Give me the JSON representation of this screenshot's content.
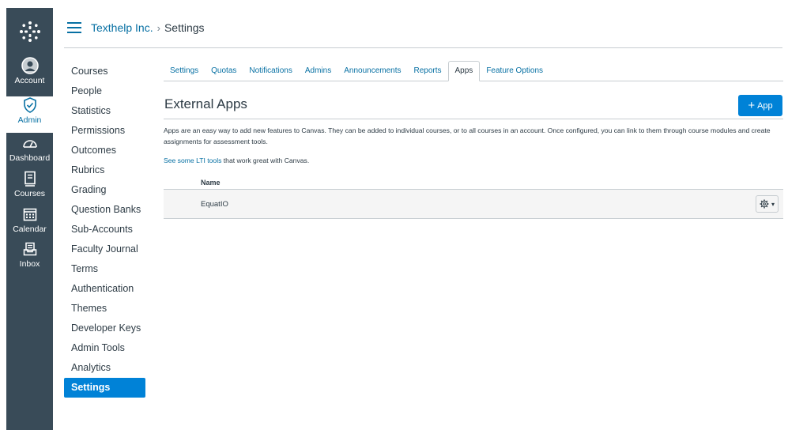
{
  "global_nav": {
    "account": "Account",
    "admin": "Admin",
    "dashboard": "Dashboard",
    "courses": "Courses",
    "calendar": "Calendar",
    "inbox": "Inbox"
  },
  "breadcrumb": {
    "account": "Texthelp Inc.",
    "separator": "›",
    "current": "Settings"
  },
  "context_nav": [
    "Courses",
    "People",
    "Statistics",
    "Permissions",
    "Outcomes",
    "Rubrics",
    "Grading",
    "Question Banks",
    "Sub-Accounts",
    "Faculty Journal",
    "Terms",
    "Authentication",
    "Themes",
    "Developer Keys",
    "Admin Tools",
    "Analytics",
    "Settings"
  ],
  "tabs": [
    "Settings",
    "Quotas",
    "Notifications",
    "Admins",
    "Announcements",
    "Reports",
    "Apps",
    "Feature Options"
  ],
  "active_tab": "Apps",
  "page": {
    "title": "External Apps",
    "add_button_label": "App",
    "description": "Apps are an easy way to add new features to Canvas. They can be added to individual courses, or to all courses in an account. Once configured, you can link to them through course modules and create assignments for assessment tools.",
    "lti_link": "See some LTI tools",
    "lti_rest": " that work great with Canvas."
  },
  "table": {
    "header_name": "Name",
    "rows": [
      {
        "name": "EquatIO"
      }
    ]
  },
  "colors": {
    "nav_bg": "#394b58",
    "accent": "#0082d7",
    "link": "#0770a3"
  }
}
